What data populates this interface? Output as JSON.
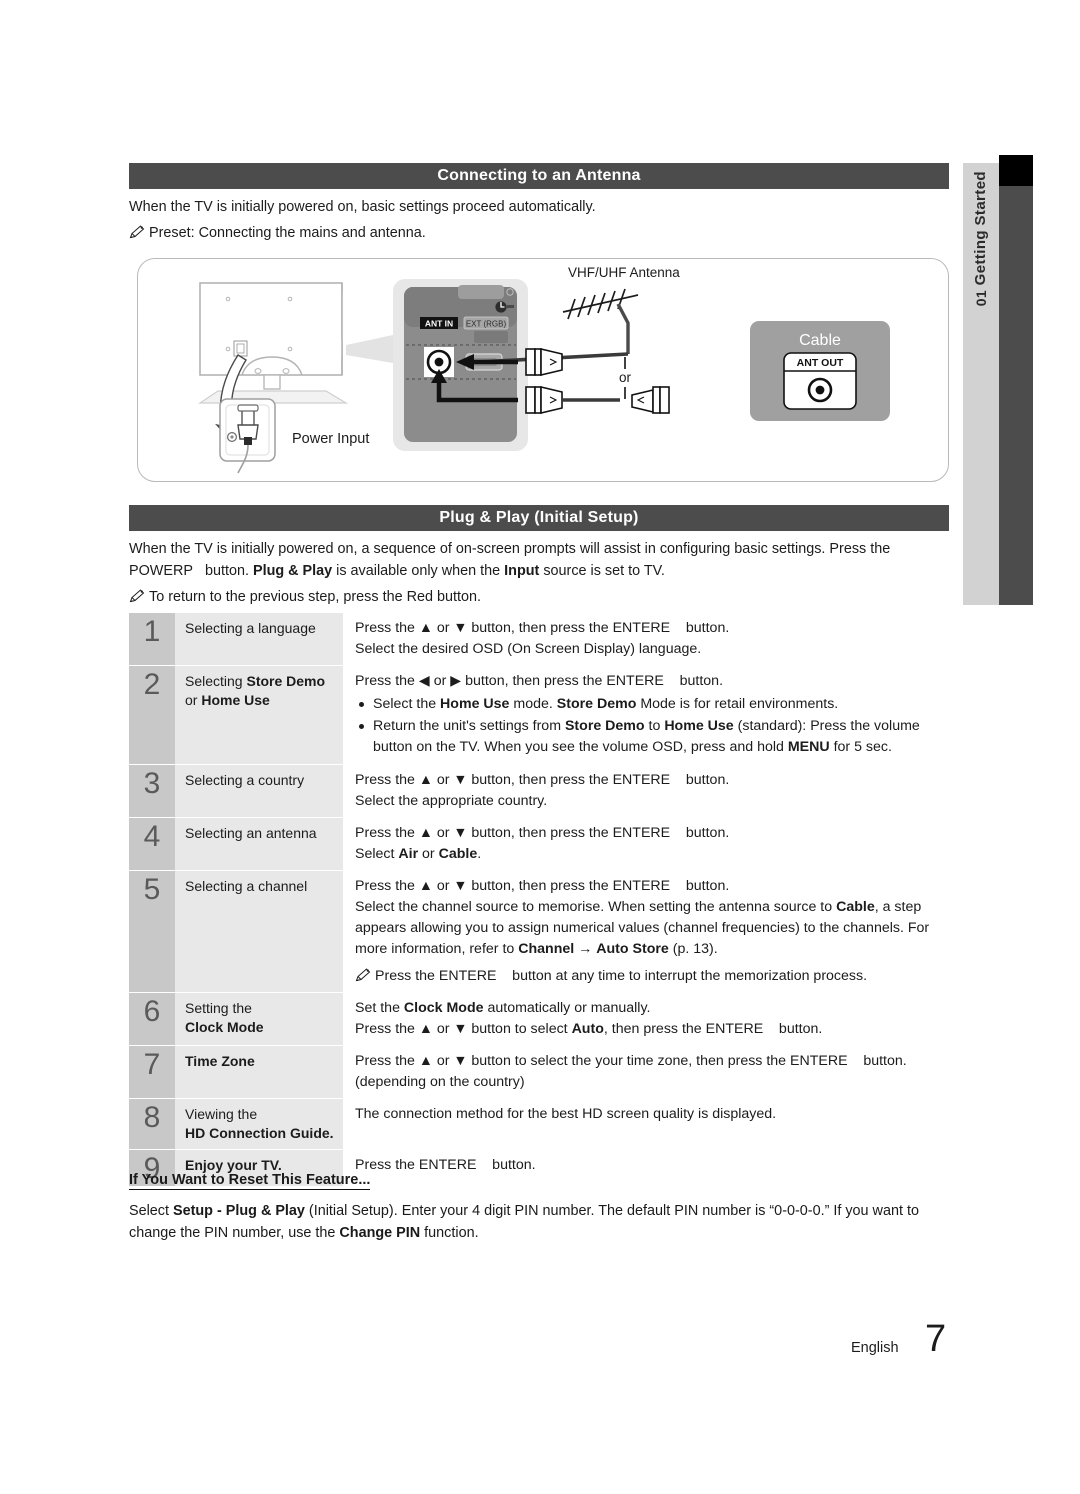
{
  "sidebar": {
    "chapter_number": "01",
    "chapter_title": "Getting Started"
  },
  "sections": {
    "antenna": {
      "heading": "Connecting to an Antenna",
      "paragraph": "When the TV is initially powered on, basic settings proceed automatically.",
      "note": "Preset: Connecting the mains and antenna."
    },
    "plugplay": {
      "heading": "Plug & Play (Initial Setup)",
      "paragraph_a": "When the TV is initially powered on, a sequence of on-screen prompts will assist in configuring basic settings. Press the",
      "paragraph_b": "POWERP",
      "paragraph_c": "button.",
      "paragraph_d": "Plug & Play",
      "paragraph_e": "is available only when the",
      "paragraph_f": "Input",
      "paragraph_g": "source is set to TV.",
      "note": "To return to the previous step, press the Red button."
    }
  },
  "diagram": {
    "label_vhf": "VHF/UHF Antenna",
    "label_cable": "Cable",
    "label_ant_out": "ANT OUT",
    "label_ant_in": "ANT IN",
    "label_ext_rgb": "EXT (RGB)",
    "label_or": "or",
    "label_power_input": "Power Input"
  },
  "power_graphic": {
    "label": "POWER"
  },
  "steps": [
    {
      "number": "1",
      "label_plain_1": "Selecting a language",
      "lines": [
        "Press the ▲ or ▼ button, then press the ENTERE   button.",
        "Select the desired OSD (On Screen Display) language."
      ]
    },
    {
      "number": "2",
      "label_plain_1": "Selecting ",
      "label_bold_1": "Store Demo",
      "label_plain_2": "or ",
      "label_bold_2": "Home Use",
      "first_line": "Press the ◀ or ▶ button, then press the ENTERE   button.",
      "bullets": [
        "Select the Home Use mode. Store Demo Mode is for retail environments.",
        "Return the unit's settings from Store Demo to Home Use (standard): Press the volume button on the TV. When you see the volume OSD, press and hold MENU for 5 sec."
      ]
    },
    {
      "number": "3",
      "label_plain_1": "Selecting a country",
      "lines": [
        "Press the ▲ or ▼ button, then press the ENTERE   button.",
        "Select the appropriate country."
      ]
    },
    {
      "number": "4",
      "label_plain_1": "Selecting an antenna",
      "lines": [
        "Press the ▲ or ▼ button, then press the ENTERE   button.",
        "Select Air or Cable."
      ]
    },
    {
      "number": "5",
      "label_plain_1": "Selecting a channel",
      "lines": [
        "Press the ▲ or ▼ button, then press the ENTERE   button.",
        "Select the channel source to memorise. When setting the antenna source to Cable, a step appears allowing you to assign numerical values (channel frequencies) to the channels. For more information, refer to Channel → Auto Store (p. 13).",
        "Press the ENTERE   button at any time to interrupt the memorization process."
      ]
    },
    {
      "number": "6",
      "label_plain_1": "Setting the",
      "label_bold_1": "Clock Mode",
      "lines": [
        "Set the Clock Mode automatically or manually.",
        "Press the ▲ or ▼ button to select Auto, then press the ENTERE   button."
      ]
    },
    {
      "number": "7",
      "label_bold_1": "Time Zone",
      "lines": [
        "Press the ▲ or ▼ button to select the your time zone, then press the ENTERE   button.",
        "(depending on the country)"
      ]
    },
    {
      "number": "8",
      "label_plain_1": "Viewing the",
      "label_bold_1": "HD Connection Guide.",
      "lines": [
        "The connection method for the best HD screen quality is displayed."
      ]
    },
    {
      "number": "9",
      "label_bold_1": "Enjoy your TV.",
      "lines": [
        "Press the ENTERE   button."
      ]
    }
  ],
  "reset": {
    "title": "If You Want to Reset This Feature...",
    "body_1": "Select ",
    "body_bold_1": "Setup - Plug & Play",
    "body_2": " (Initial Setup). Enter your 4 digit PIN number. The default PIN number is “0-0-0-0.” If you want to change the PIN number, use the ",
    "body_bold_2": "Change PIN",
    "body_3": " function."
  },
  "footer": {
    "language": "English",
    "page_number": "7"
  },
  "colors": {
    "header_bar": "#4c4c4c",
    "step_num_bg": "#c8c8c8",
    "step_label_bg": "#e8e8e8",
    "sidetab_bg": "#d2d2d2"
  }
}
